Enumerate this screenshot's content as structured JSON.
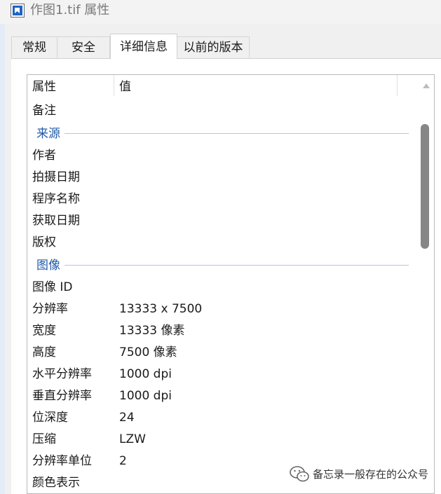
{
  "window": {
    "title": "作图1.tif 属性"
  },
  "tabs": [
    {
      "label": "常规"
    },
    {
      "label": "安全"
    },
    {
      "label": "详细信息"
    },
    {
      "label": "以前的版本"
    }
  ],
  "columns": {
    "property": "属性",
    "value": "值"
  },
  "rows": {
    "remarks": {
      "label": "备注",
      "value": ""
    },
    "source_group": "来源",
    "author": {
      "label": "作者",
      "value": ""
    },
    "date_taken": {
      "label": "拍摄日期",
      "value": ""
    },
    "program_name": {
      "label": "程序名称",
      "value": ""
    },
    "date_acquired": {
      "label": "获取日期",
      "value": ""
    },
    "copyright": {
      "label": "版权",
      "value": ""
    },
    "image_group": "图像",
    "image_id": {
      "label": "图像 ID",
      "value": ""
    },
    "resolution": {
      "label": "分辨率",
      "value": "13333 x 7500"
    },
    "width": {
      "label": "宽度",
      "value": "13333 像素"
    },
    "height": {
      "label": "高度",
      "value": "7500 像素"
    },
    "h_resolution": {
      "label": "水平分辨率",
      "value": "1000 dpi"
    },
    "v_resolution": {
      "label": "垂直分辨率",
      "value": "1000 dpi"
    },
    "bit_depth": {
      "label": "位深度",
      "value": "24"
    },
    "compression": {
      "label": "压缩",
      "value": "LZW"
    },
    "resolution_unit": {
      "label": "分辨率单位",
      "value": "2"
    },
    "color_representation": {
      "label": "颜色表示",
      "value": ""
    }
  },
  "watermark": {
    "text": "备忘录一般存在的公众号",
    "icon": "wechat-logo-icon"
  },
  "colors": {
    "group_header": "#1f5aa8",
    "scroll_thumb": "#868686",
    "app_icon": "#1f63c5"
  }
}
